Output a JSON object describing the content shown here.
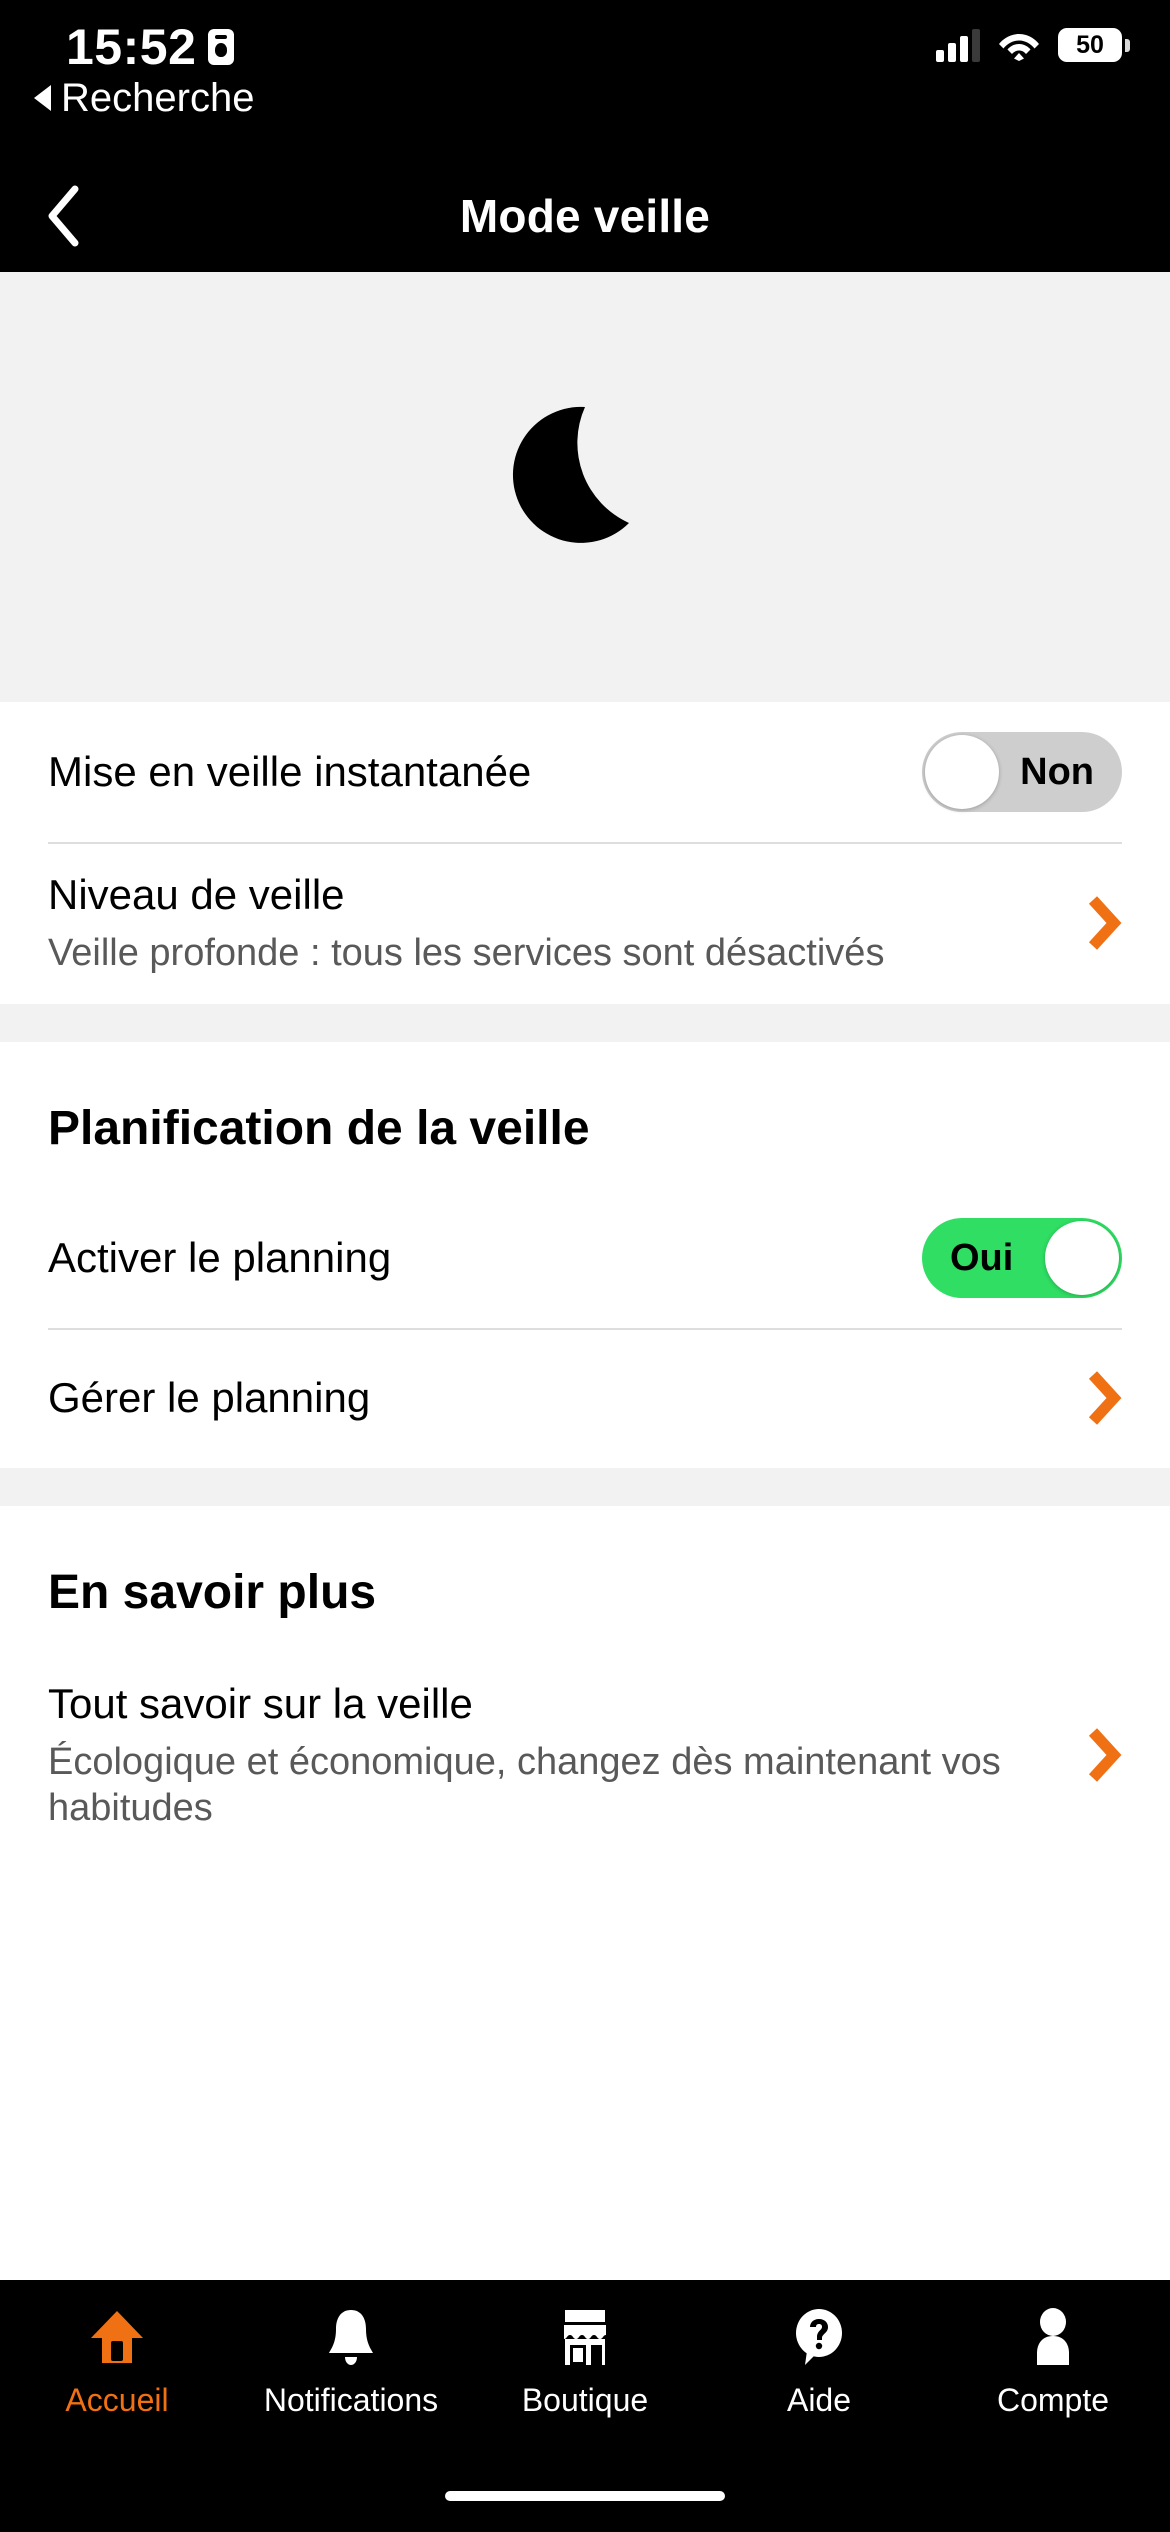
{
  "status_bar": {
    "time": "15:52",
    "recording_icon": "id-card-icon",
    "back_link": "Recherche",
    "signal_icon": "cellular-signal-icon",
    "wifi_icon": "wifi-icon",
    "battery_level": "50"
  },
  "nav": {
    "back_icon": "chevron-left-icon",
    "title": "Mode veille"
  },
  "hero": {
    "icon": "crescent-moon-icon",
    "background": "#f2f2f2"
  },
  "sections": [
    {
      "rows": [
        {
          "title": "Mise en veille instantanée",
          "subtitle": "",
          "control": "toggle",
          "toggle_state": "off",
          "toggle_label": "Non"
        },
        {
          "title": "Niveau de veille",
          "subtitle": "Veille profonde : tous les services sont désactivés",
          "control": "chevron",
          "chevron_icon": "chevron-right-icon"
        }
      ]
    },
    {
      "heading": "Planification de la veille",
      "rows": [
        {
          "title": "Activer le planning",
          "subtitle": "",
          "control": "toggle",
          "toggle_state": "on",
          "toggle_label": "Oui"
        },
        {
          "title": "Gérer le planning",
          "subtitle": "",
          "control": "chevron",
          "chevron_icon": "chevron-right-icon"
        }
      ]
    },
    {
      "heading": "En savoir plus",
      "rows": [
        {
          "title": "Tout savoir sur la veille",
          "subtitle": "Écologique et économique, changez dès maintenant vos habitudes",
          "control": "chevron",
          "chevron_icon": "chevron-right-icon"
        }
      ]
    }
  ],
  "tabbar": {
    "items": [
      {
        "label": "Accueil",
        "icon": "home-icon",
        "active": true
      },
      {
        "label": "Notifications",
        "icon": "bell-icon",
        "active": false
      },
      {
        "label": "Boutique",
        "icon": "shop-icon",
        "active": false
      },
      {
        "label": "Aide",
        "icon": "question-bubble-icon",
        "active": false
      },
      {
        "label": "Compte",
        "icon": "person-icon",
        "active": false
      }
    ]
  },
  "colors": {
    "accent_orange": "#f07014",
    "toggle_on_green": "#2fde63",
    "toggle_off_gray": "#cecece",
    "band_gray": "#f2f2f2",
    "subtitle_gray": "#595959",
    "black": "#000000"
  }
}
